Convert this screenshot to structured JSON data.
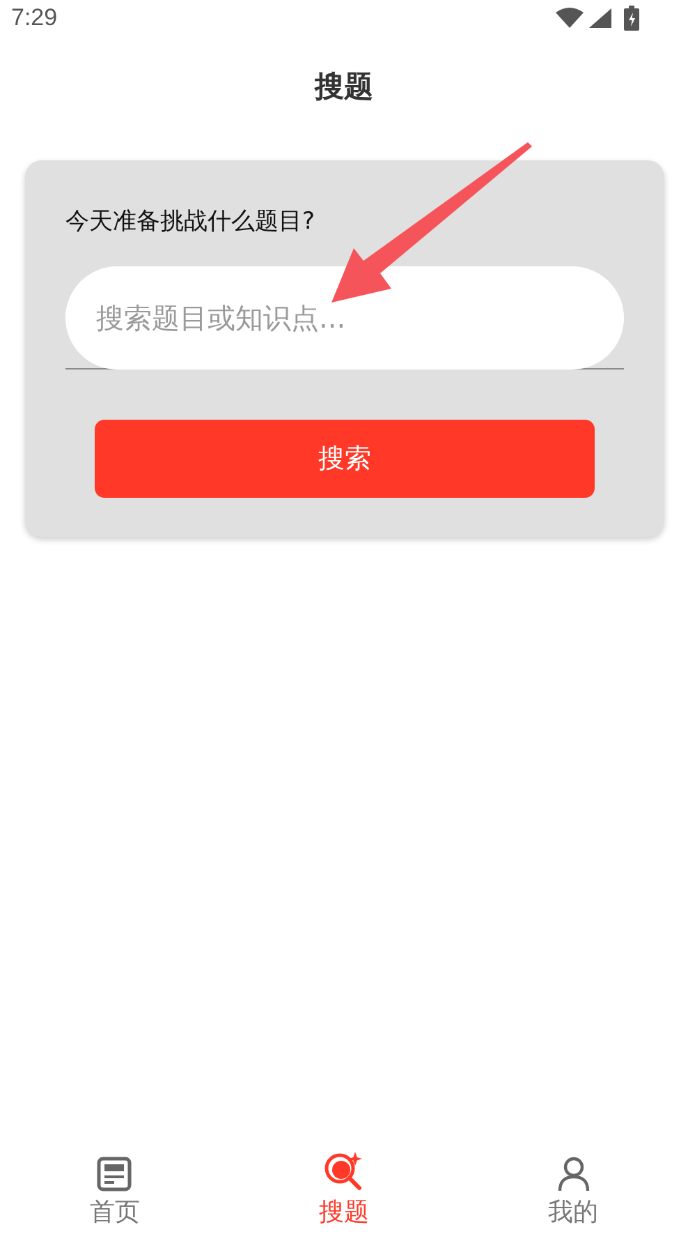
{
  "status_bar": {
    "time": "7:29"
  },
  "header": {
    "title": "搜题"
  },
  "search_card": {
    "prompt": "今天准备挑战什么题目?",
    "field": {
      "placeholder": "搜索题目或知识点..."
    },
    "button": "搜索"
  },
  "annotation": {
    "kind": "arrow"
  },
  "bottom_nav": [
    {
      "label": "首页",
      "kind": "home",
      "selected": false
    },
    {
      "label": "搜题",
      "kind": "search",
      "selected": true
    },
    {
      "label": "我的",
      "kind": "profile",
      "selected": false
    }
  ]
}
